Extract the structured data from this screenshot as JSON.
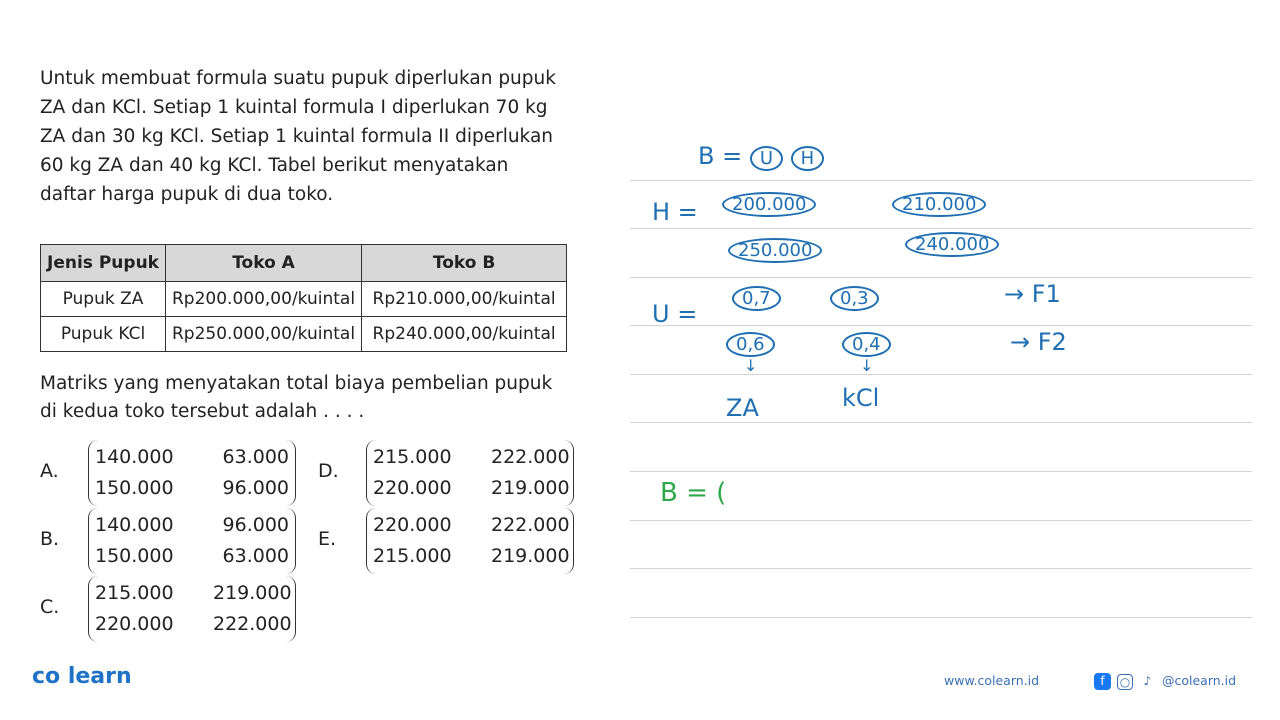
{
  "question": {
    "intro": "Untuk membuat formula suatu pupuk diperlukan pupuk ZA dan KCl. Setiap 1 kuintal formula I diperlukan 70 kg ZA dan 30 kg KCl. Setiap 1 kuintal formula II diperlukan 60 kg ZA dan 40 kg KCl. Tabel berikut menyatakan daftar harga pupuk di dua toko.",
    "table": {
      "headers": [
        "Jenis Pupuk",
        "Toko A",
        "Toko B"
      ],
      "rows": [
        [
          "Pupuk ZA",
          "Rp200.000,00/kuintal",
          "Rp210.000,00/kuintal"
        ],
        [
          "Pupuk KCl",
          "Rp250.000,00/kuintal",
          "Rp240.000,00/kuintal"
        ]
      ]
    },
    "ask": "Matriks yang menyatakan total biaya pembelian pupuk di kedua toko tersebut adalah . . . .",
    "choices": [
      {
        "label": "A.",
        "m": [
          [
            "140.000",
            "63.000"
          ],
          [
            "150.000",
            "96.000"
          ]
        ]
      },
      {
        "label": "B.",
        "m": [
          [
            "140.000",
            "96.000"
          ],
          [
            "150.000",
            "63.000"
          ]
        ]
      },
      {
        "label": "C.",
        "m": [
          [
            "215.000",
            "219.000"
          ],
          [
            "220.000",
            "222.000"
          ]
        ]
      },
      {
        "label": "D.",
        "m": [
          [
            "215.000",
            "222.000"
          ],
          [
            "220.000",
            "219.000"
          ]
        ]
      },
      {
        "label": "E.",
        "m": [
          [
            "220.000",
            "222.000"
          ],
          [
            "215.000",
            "219.000"
          ]
        ]
      }
    ]
  },
  "notes": {
    "b_eq": "B =",
    "u": "U",
    "h": "H",
    "h_eq": "H =",
    "h_vals": [
      "200.000",
      "210.000",
      "250.000",
      "240.000"
    ],
    "u_eq": "U =",
    "u_vals": [
      "0,7",
      "0,3",
      "0,6",
      "0,4"
    ],
    "f1": "→ F1",
    "f2": "→ F2",
    "za": "ZA",
    "kcl": "kCl",
    "b2": "B = ("
  },
  "footer": {
    "brand": "co learn",
    "website": "www.colearn.id",
    "social": "@colearn.id"
  },
  "colors": {
    "ink": "#1f6fb2",
    "green": "#2da84a",
    "brand": "#1f73c6"
  }
}
